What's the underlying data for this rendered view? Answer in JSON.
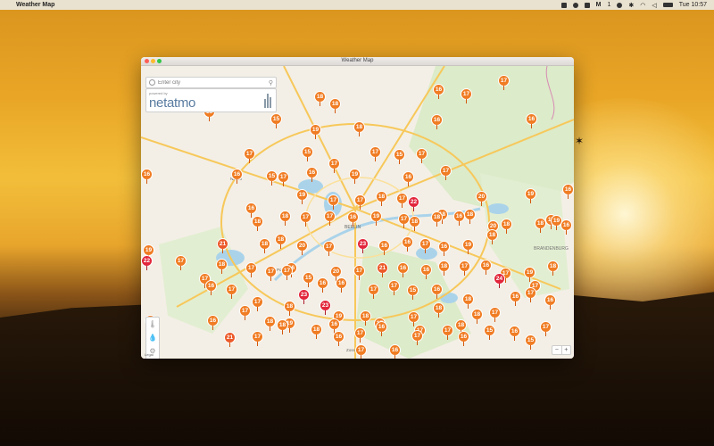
{
  "menubar": {
    "app_name": "Weather Map",
    "clock": "Tue 10:57",
    "status_item_m": "1",
    "icons": [
      "apple-icon",
      "dropbox-icon",
      "bell-icon",
      "monitor-icon",
      "m-status-icon",
      "time-machine-icon",
      "bluetooth-icon",
      "wifi-icon",
      "volume-icon",
      "battery-icon"
    ]
  },
  "window": {
    "title": "Weather Map",
    "search": {
      "placeholder": "Enter city",
      "value": ""
    },
    "brand": {
      "powered_by": "powered by",
      "logo": "netatmo"
    },
    "legal": "Legal",
    "zoom": {
      "out": "−",
      "in": "+"
    },
    "tools": [
      "thermometer-icon",
      "raindrop-icon",
      "gear-icon"
    ]
  },
  "map": {
    "labels": [
      "BERLIN",
      "Potsdam",
      "Nauen",
      "Zossen",
      "BRANDENBURG",
      "Königs Wusterhausen",
      "Strausberg",
      "Bernau",
      "Oranienburg",
      "Falkensee",
      "Teltow",
      "Erkner",
      "Fürstenwalde/Spree"
    ],
    "pins": [
      "17",
      "16",
      "17",
      "18",
      "18",
      "16",
      "15",
      "19",
      "18",
      "16",
      "16",
      "17",
      "17",
      "15",
      "17",
      "15",
      "17",
      "16",
      "16",
      "15",
      "16",
      "17",
      "19",
      "16",
      "17",
      "20",
      "19",
      "16",
      "18",
      "19",
      "17",
      "17",
      "18",
      "17",
      "22",
      "18",
      "18",
      "18",
      "18",
      "17",
      "17",
      "16",
      "19",
      "17",
      "18",
      "18",
      "16",
      "20",
      "18",
      "19",
      "21",
      "18",
      "20",
      "17",
      "23",
      "16",
      "16",
      "17",
      "16",
      "19",
      "18",
      "18",
      "16",
      "17",
      "16",
      "22",
      "17",
      "18",
      "17",
      "16",
      "20",
      "17",
      "21",
      "16",
      "16",
      "18",
      "17",
      "16",
      "17",
      "19",
      "18",
      "19",
      "24",
      "17",
      "17",
      "17",
      "17",
      "15",
      "16",
      "16",
      "17",
      "17",
      "15",
      "16",
      "18",
      "16",
      "17",
      "18",
      "16",
      "17",
      "18",
      "19",
      "18",
      "17",
      "17",
      "17",
      "18",
      "18",
      "18",
      "17",
      "17",
      "16",
      "16",
      "17",
      "18",
      "19",
      "18",
      "16",
      "16",
      "17",
      "16",
      "17",
      "17",
      "16",
      "15",
      "16",
      "15",
      "17",
      "17",
      "21",
      "22",
      "22",
      "18",
      "23",
      "23",
      "17",
      "17",
      "16",
      "20",
      "18",
      "18"
    ]
  },
  "colors": {
    "pin": "#f07c23",
    "pin_hot": "#e2263b"
  }
}
